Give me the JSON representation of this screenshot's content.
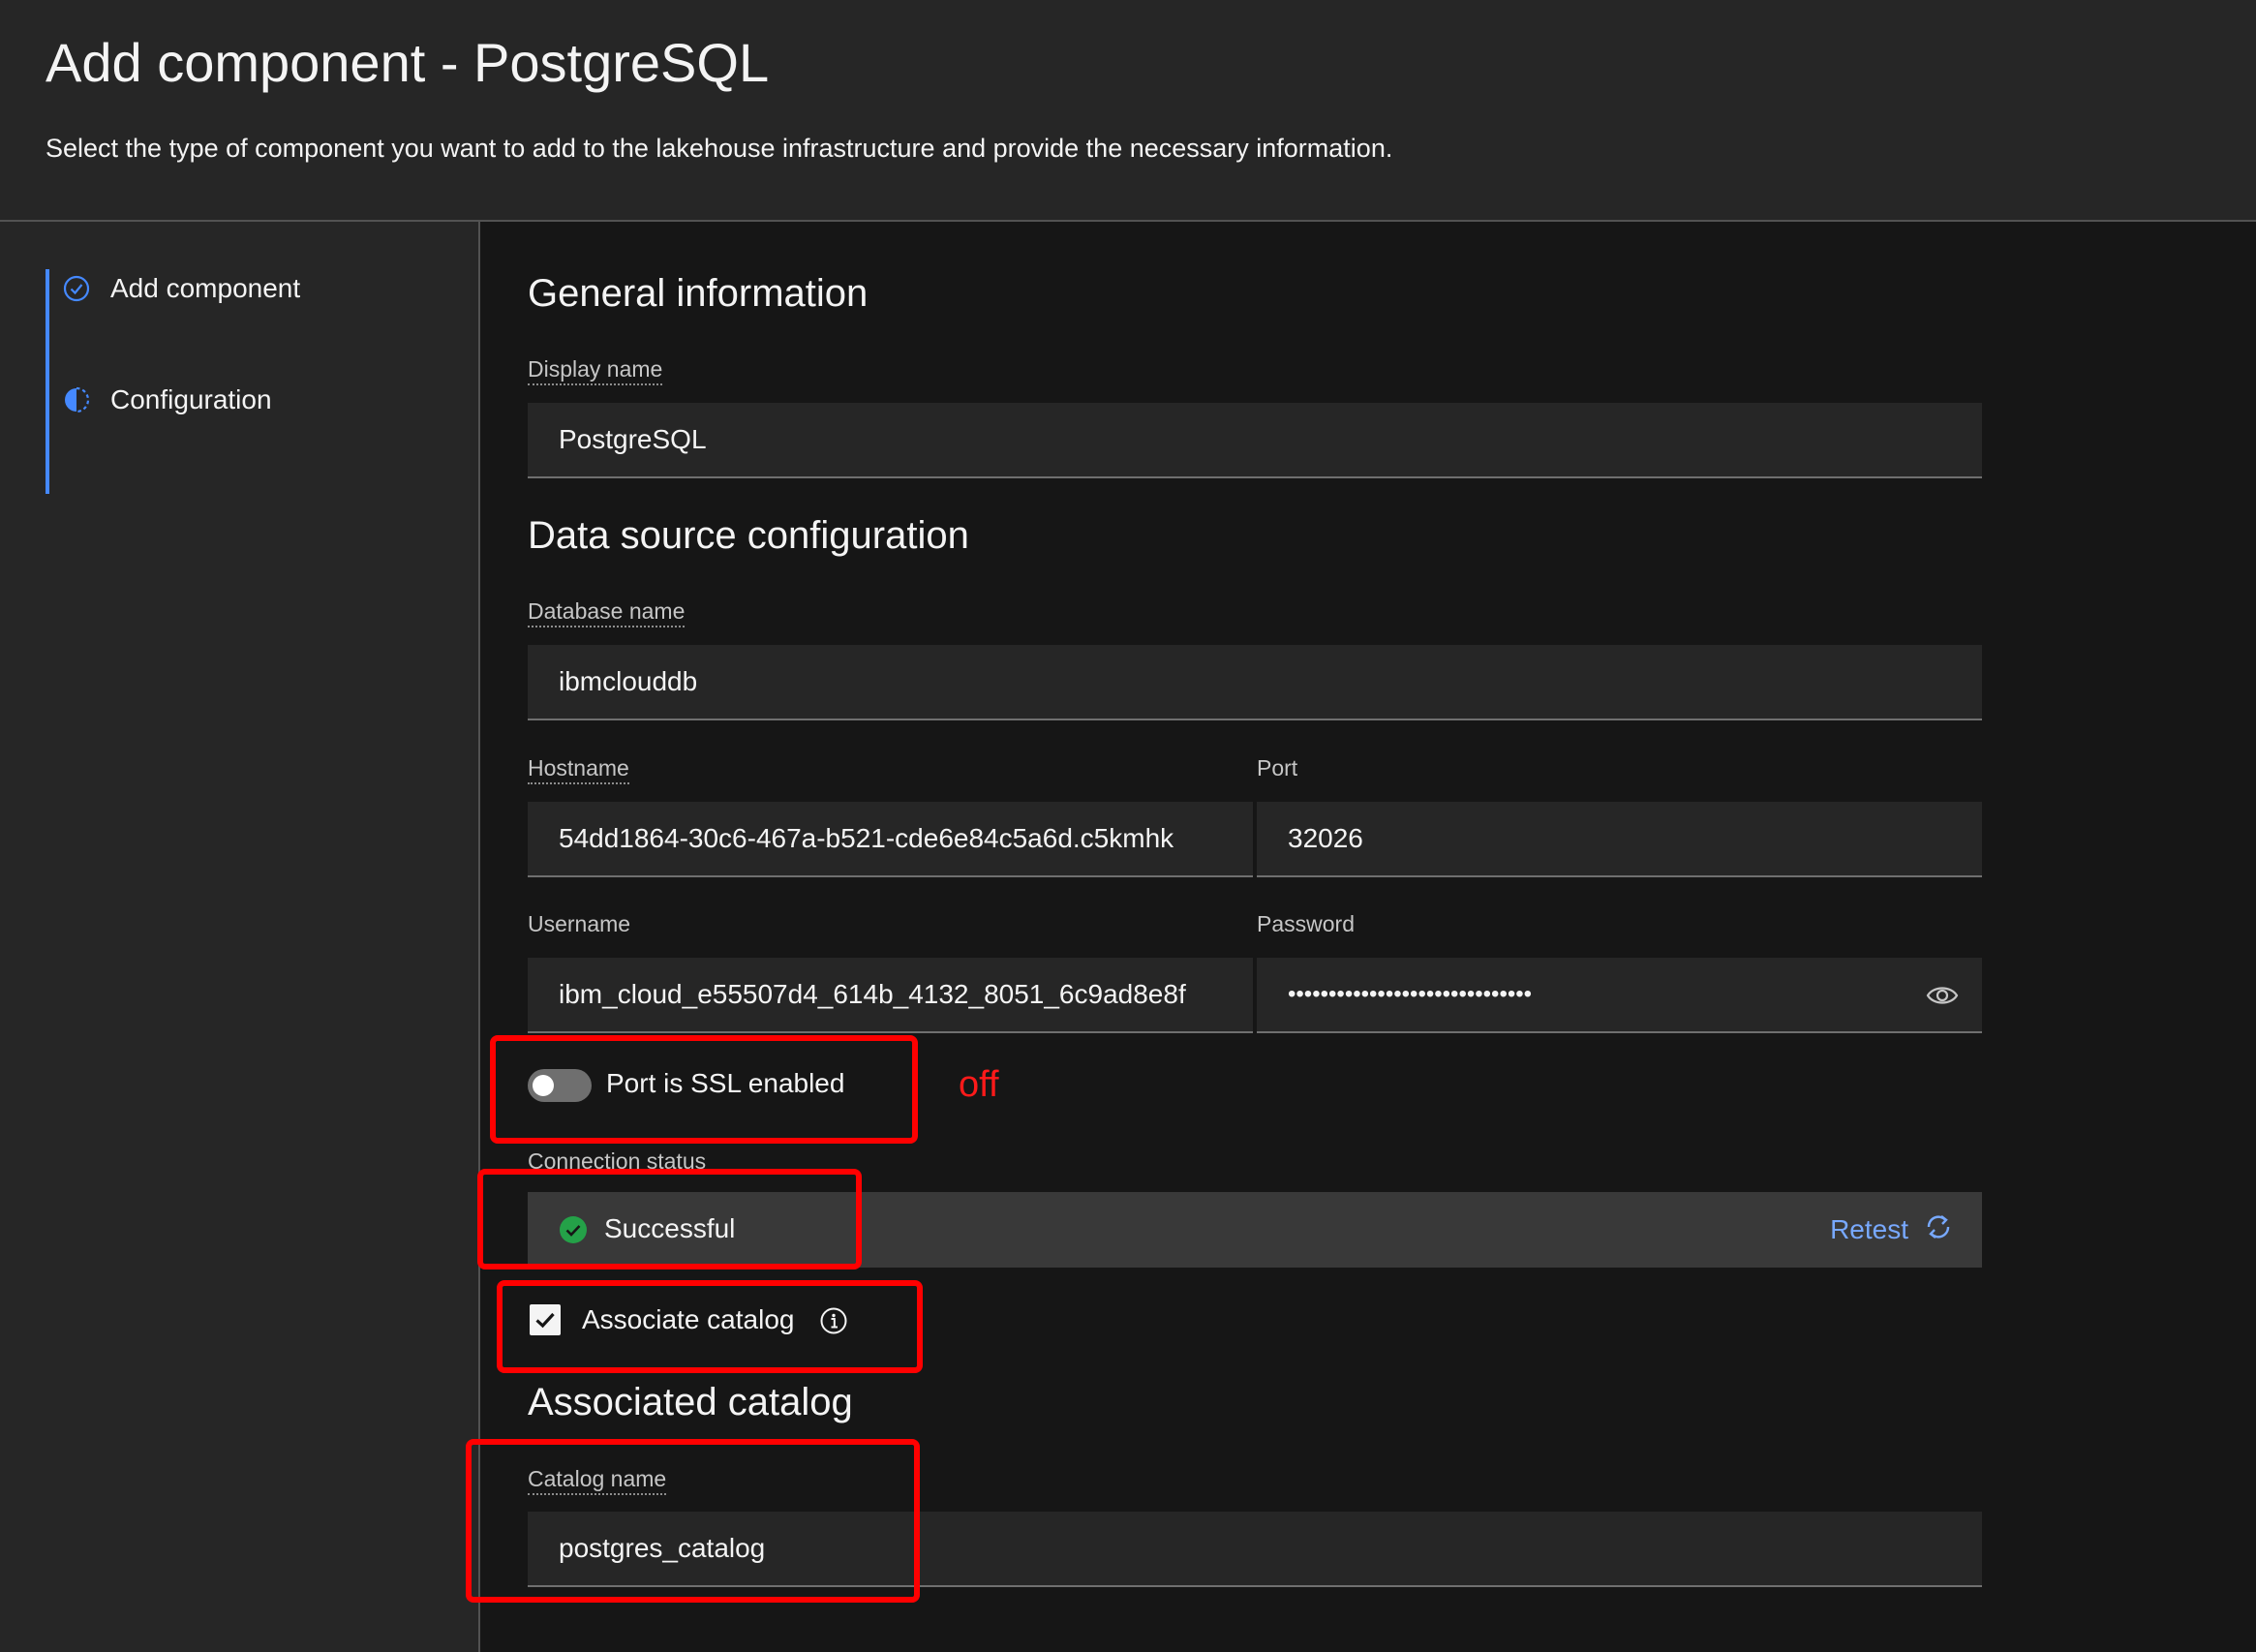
{
  "header": {
    "title": "Add component - PostgreSQL",
    "subtitle": "Select the type of component you want to add to the lakehouse infrastructure and provide the necessary information."
  },
  "sidebar": {
    "steps": [
      {
        "label": "Add component",
        "state": "complete",
        "icon": "checkmark-outline-icon"
      },
      {
        "label": "Configuration",
        "state": "current",
        "icon": "incomplete-icon"
      }
    ]
  },
  "general": {
    "title": "General information",
    "display_name": {
      "label": "Display name",
      "value": "PostgreSQL"
    }
  },
  "datasource": {
    "title": "Data source configuration",
    "database_name": {
      "label": "Database name",
      "value": "ibmclouddb"
    },
    "hostname": {
      "label": "Hostname",
      "value": "54dd1864-30c6-467a-b521-cde6e84c5a6d.c5kmhk"
    },
    "port": {
      "label": "Port",
      "value": "32026"
    },
    "username": {
      "label": "Username",
      "value": "ibm_cloud_e55507d4_614b_4132_8051_6c9ad8e8f"
    },
    "password": {
      "label": "Password",
      "value": "••••••••••••••••••••••••••••••"
    },
    "ssl_toggle": {
      "label": "Port is SSL enabled",
      "state": "off"
    },
    "annotation": "off"
  },
  "connection": {
    "label": "Connection status",
    "status": "Successful",
    "retest_label": "Retest"
  },
  "associate": {
    "checkbox_label": "Associate catalog",
    "checked": true
  },
  "catalog": {
    "title": "Associated catalog",
    "catalog_name": {
      "label": "Catalog name",
      "value": "postgres_catalog"
    }
  },
  "colors": {
    "accent": "#4589ff",
    "link": "#78a9ff",
    "success": "#24a148",
    "highlight": "#ff0000"
  }
}
